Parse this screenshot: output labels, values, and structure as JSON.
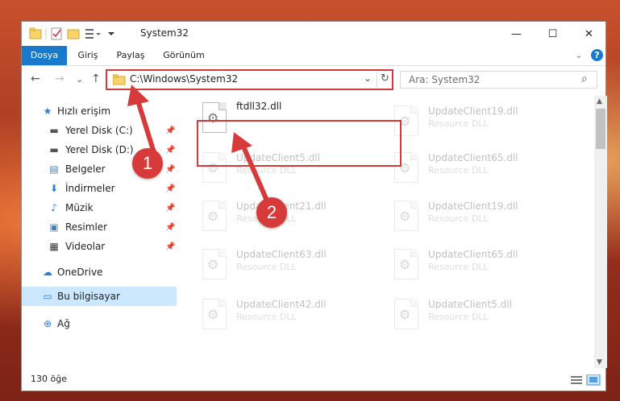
{
  "window": {
    "title": "System32",
    "minimize": "—",
    "maximize": "☐",
    "close": "✕"
  },
  "ribbon": {
    "tabs": [
      "Dosya",
      "Giriş",
      "Paylaş",
      "Görünüm"
    ],
    "collapse": "⌄",
    "help": "?"
  },
  "navigation": {
    "back": "←",
    "forward": "→",
    "recent": "⌄",
    "up": "↑",
    "address": "C:\\Windows\\System32",
    "address_dropdown": "⌄",
    "refresh": "↻"
  },
  "search": {
    "placeholder": "Ara: System32",
    "icon": "⌕"
  },
  "sidebar": {
    "items": [
      {
        "label": "Hızlı erişim",
        "icon": "★",
        "pinned": false
      },
      {
        "label": "Yerel Disk (C:)",
        "icon": "▬",
        "pinned": true
      },
      {
        "label": "Yerel Disk (D:)",
        "icon": "▬",
        "pinned": true
      },
      {
        "label": "Belgeler",
        "icon": "▤",
        "pinned": true
      },
      {
        "label": "İndirmeler",
        "icon": "⬇",
        "pinned": true
      },
      {
        "label": "Müzik",
        "icon": "♪",
        "pinned": true
      },
      {
        "label": "Resimler",
        "icon": "▣",
        "pinned": true
      },
      {
        "label": "Videolar",
        "icon": "▦",
        "pinned": true
      },
      {
        "label": "OneDrive",
        "icon": "☁",
        "pinned": false
      },
      {
        "label": "Bu bilgisayar",
        "icon": "▭",
        "pinned": false
      },
      {
        "label": "Ağ",
        "icon": "⊕",
        "pinned": false
      }
    ],
    "pin_glyph": "📌"
  },
  "files": {
    "highlighted": {
      "name": "ftdll32.dll"
    },
    "left_column": [
      {
        "name": "UpdateClient5.dll",
        "type": "Resource DLL"
      },
      {
        "name": "UpdateClient21.dll",
        "type": "Resource DLL"
      },
      {
        "name": "UpdateClient63.dll",
        "type": "Resource DLL"
      },
      {
        "name": "UpdateClient42.dll",
        "type": "Resource DLL"
      }
    ],
    "right_column": [
      {
        "name": "UpdateClient19.dll",
        "type": "Resource DLL"
      },
      {
        "name": "UpdateClient65.dll",
        "type": "Resource DLL"
      },
      {
        "name": "UpdateClient19.dll",
        "type": "Resource DLL"
      },
      {
        "name": "UpdateClient65.dll",
        "type": "Resource DLL"
      },
      {
        "name": "UpdateClient5.dll",
        "type": "Resource DLL"
      }
    ]
  },
  "status": {
    "count": "130 öğe"
  },
  "annotations": {
    "step1": "1",
    "step2": "2",
    "color": "#d63a3a"
  }
}
